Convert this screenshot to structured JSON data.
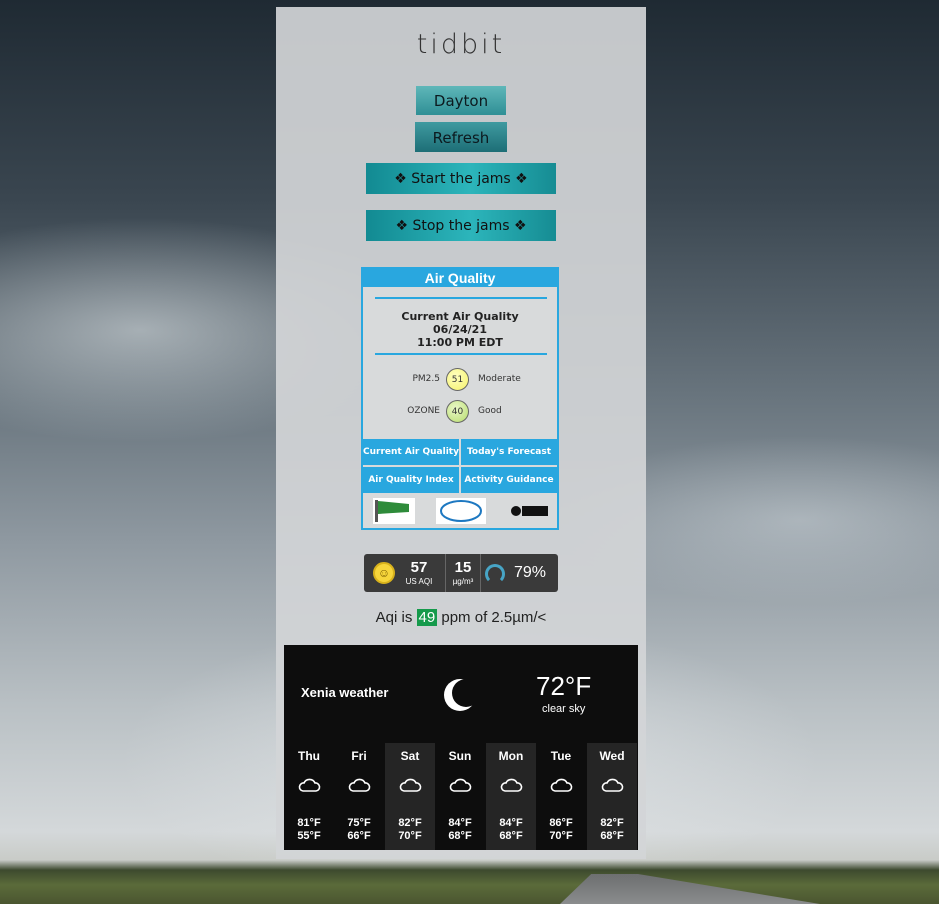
{
  "app": {
    "logo": "tidbit"
  },
  "buttons": {
    "city": "Dayton",
    "refresh": "Refresh",
    "start_jams": "❖ Start the jams ❖",
    "stop_jams": "❖ Stop the jams ❖"
  },
  "air_quality": {
    "title": "Air Quality",
    "heading": "Current Air Quality",
    "date": "06/24/21",
    "time": "11:00 PM EDT",
    "readings": [
      {
        "label": "PM2.5",
        "value": "51",
        "category": "Moderate",
        "color": "#f5f26a"
      },
      {
        "label": "OZONE",
        "value": "40",
        "category": "Good",
        "color": "#b7dd6e"
      }
    ],
    "links": [
      "Current Air Quality",
      "Today's Forecast",
      "Air Quality Index",
      "Activity Guidance"
    ],
    "logos": [
      "Air Quality Flag PROGRAM",
      "AirNow",
      "EPA"
    ]
  },
  "aqi_widget": {
    "aqi_value": "57",
    "aqi_label": "US AQI",
    "pm_value": "15",
    "pm_unit": "µg/m³",
    "humidity": "79%"
  },
  "aqi_line": {
    "prefix": "Aqi is",
    "value": "49",
    "suffix": "ppm of 2.5µm/<"
  },
  "weather": {
    "city": "Xenia weather",
    "icon": "moon-icon",
    "temp": "72°F",
    "desc": "clear sky",
    "days": [
      {
        "name": "Thu",
        "high": "81°F",
        "low": "55°F"
      },
      {
        "name": "Fri",
        "high": "75°F",
        "low": "66°F"
      },
      {
        "name": "Sat",
        "high": "82°F",
        "low": "70°F"
      },
      {
        "name": "Sun",
        "high": "84°F",
        "low": "68°F"
      },
      {
        "name": "Mon",
        "high": "84°F",
        "low": "68°F"
      },
      {
        "name": "Tue",
        "high": "86°F",
        "low": "70°F"
      },
      {
        "name": "Wed",
        "high": "82°F",
        "low": "68°F"
      }
    ],
    "day_icon": "cloud-rain-icon"
  },
  "colors": {
    "accent": "#29a7df",
    "teal": "#1d8e95",
    "aqi_badge": "#159a4b"
  }
}
